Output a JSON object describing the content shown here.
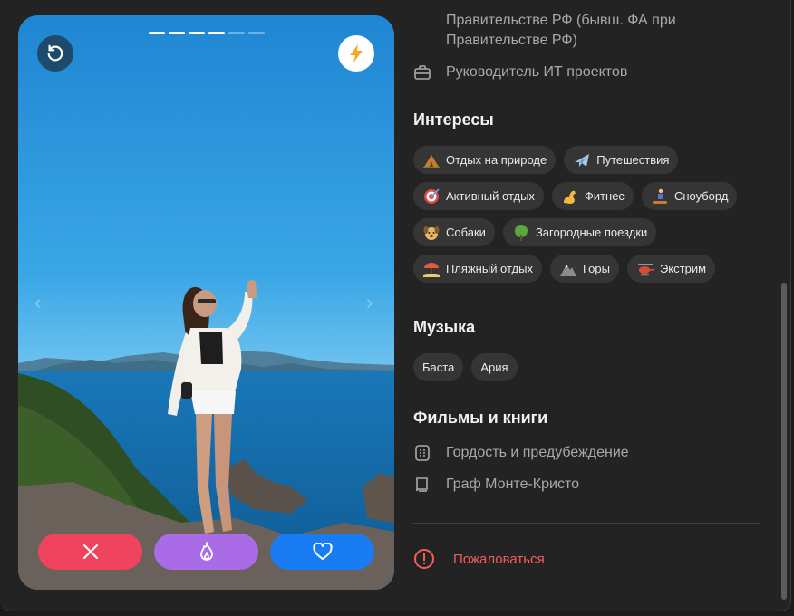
{
  "card": {
    "photo_count": 6,
    "current_photo": 4,
    "photo_alt": ""
  },
  "profile": {
    "education_lines": [
      "Правительстве РФ (бывш. ФА при",
      "Правительстве РФ)"
    ],
    "job": "Руководитель ИТ проектов"
  },
  "interests": {
    "title": "Интересы",
    "items": [
      {
        "label": "Отдых на природе",
        "icon": "camp-icon"
      },
      {
        "label": "Путешествия",
        "icon": "airplane-icon"
      },
      {
        "label": "Активный отдых",
        "icon": "target-icon"
      },
      {
        "label": "Фитнес",
        "icon": "flexed-biceps-icon"
      },
      {
        "label": "Сноуборд",
        "icon": "snowboarder-icon"
      },
      {
        "label": "Собаки",
        "icon": "dog-icon"
      },
      {
        "label": "Загородные поездки",
        "icon": "tree-icon"
      },
      {
        "label": "Пляжный отдых",
        "icon": "beach-icon"
      },
      {
        "label": "Горы",
        "icon": "mountain-icon"
      },
      {
        "label": "Экстрим",
        "icon": "helicopter-icon"
      }
    ]
  },
  "music": {
    "title": "Музыка",
    "items": [
      "Баста",
      "Ария"
    ]
  },
  "movies_books": {
    "title": "Фильмы и книги",
    "items": [
      {
        "label": "Гордость и предубеждение",
        "icon": "film-icon"
      },
      {
        "label": "Граф Монте-Кристо",
        "icon": "book-icon"
      }
    ]
  },
  "report": {
    "label": "Пожаловаться"
  },
  "colors": {
    "dislike": "#f0435d",
    "superlike": "#a96be6",
    "like": "#1a7cf2",
    "report": "#f45c5c"
  }
}
